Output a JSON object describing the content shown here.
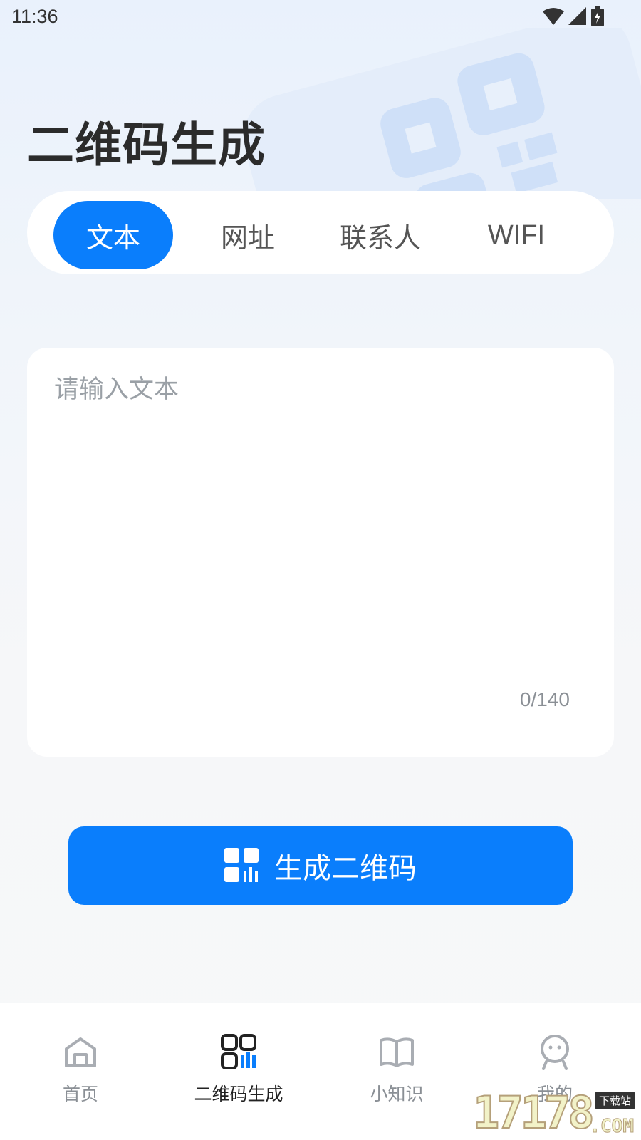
{
  "status_bar": {
    "time": "11:36"
  },
  "header": {
    "title": "二维码生成"
  },
  "tabs": [
    {
      "label": "文本",
      "active": true
    },
    {
      "label": "网址",
      "active": false
    },
    {
      "label": "联系人",
      "active": false
    },
    {
      "label": "WIFI",
      "active": false
    }
  ],
  "input": {
    "placeholder": "请输入文本",
    "value": "",
    "counter": "0/140"
  },
  "generate_button": {
    "label": "生成二维码"
  },
  "bottom_nav": {
    "items": [
      {
        "label": "首页",
        "icon": "home-icon",
        "active": false
      },
      {
        "label": "二维码生成",
        "icon": "qr-code-icon",
        "active": true
      },
      {
        "label": "小知识",
        "icon": "book-icon",
        "active": false
      },
      {
        "label": "我的",
        "icon": "profile-icon",
        "active": false
      }
    ]
  },
  "watermark": {
    "number": "17178",
    "tag": "下载站",
    "suffix": ".COM"
  },
  "colors": {
    "accent": "#0a7efc",
    "background": "#f5f7fa",
    "muted_text": "#8a8f95"
  }
}
